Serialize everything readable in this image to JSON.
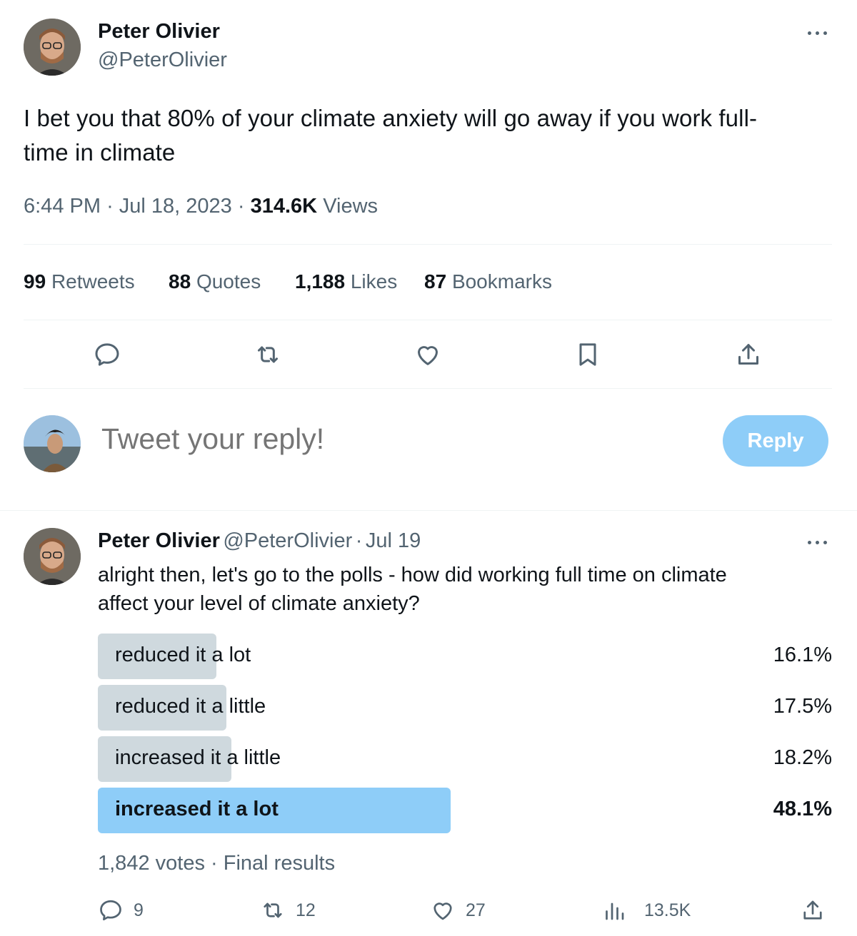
{
  "main_tweet": {
    "author_name": "Peter Olivier",
    "author_handle": "@PeterOlivier",
    "text": "I bet you that 80% of your climate anxiety will go away if you work full-time in climate",
    "text_line1": "I bet you that 80% of your climate anxiety will go away if you work full-",
    "text_line2": "time in climate",
    "time": "6:44 PM",
    "date": "Jul 18, 2023",
    "views_count": "314.6K",
    "views_label": "Views",
    "stats": {
      "retweets_count": "99",
      "retweets_label": "Retweets",
      "quotes_count": "88",
      "quotes_label": "Quotes",
      "likes_count": "1,188",
      "likes_label": "Likes",
      "bookmarks_count": "87",
      "bookmarks_label": "Bookmarks"
    },
    "actions": [
      "reply-icon",
      "retweet-icon",
      "like-icon",
      "bookmark-icon",
      "share-icon"
    ]
  },
  "composer": {
    "placeholder": "Tweet your reply!",
    "reply_button_label": "Reply"
  },
  "reply_tweet": {
    "author_name": "Peter Olivier",
    "author_handle": "@PeterOlivier",
    "separator": "·",
    "date": "Jul 19",
    "text_line1": "alright then, let's go to the polls - how did working full time on climate",
    "text_line2": "affect your level of climate anxiety?",
    "poll": {
      "options": [
        {
          "label": "reduced it a lot",
          "percent_label": "16.1%",
          "percent": 16.1,
          "winner": false
        },
        {
          "label": "reduced it a little",
          "percent_label": "17.5%",
          "percent": 17.5,
          "winner": false
        },
        {
          "label": "increased it a little",
          "percent_label": "18.2%",
          "percent": 18.2,
          "winner": false
        },
        {
          "label": "increased it a lot",
          "percent_label": "48.1%",
          "percent": 48.1,
          "winner": true
        }
      ],
      "votes": "1,842 votes",
      "status": "Final results"
    },
    "counts": {
      "replies": "9",
      "retweets": "12",
      "likes": "27",
      "views": "13.5K"
    }
  },
  "colors": {
    "text_primary": "#0f1419",
    "text_secondary": "#536471",
    "accent": "#1d9bf0",
    "reply_button_disabled": "#8ecdf8",
    "poll_bar": "#cfd9de",
    "poll_bar_winner": "#8ecdf8"
  }
}
